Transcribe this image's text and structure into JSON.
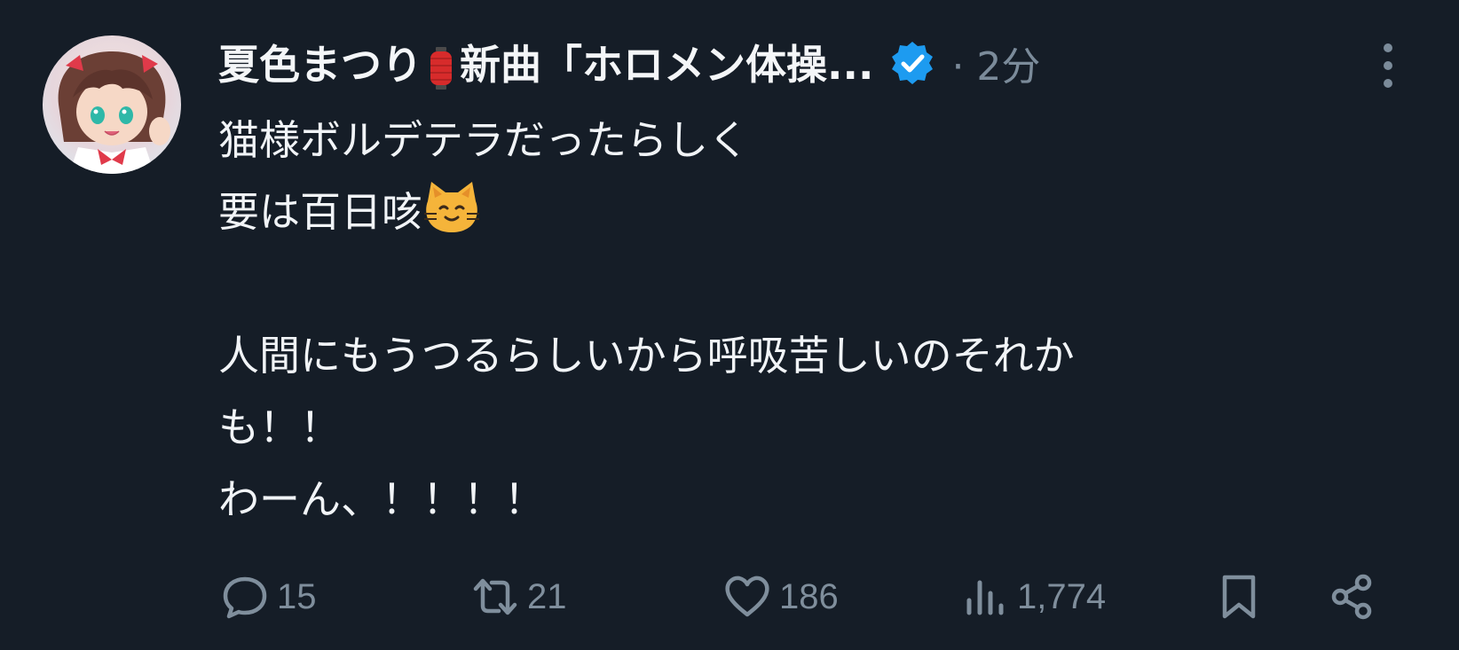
{
  "post": {
    "display_name": "夏色まつり",
    "name_emoji": "red-paper-lantern",
    "name_suffix": "新曲「ホロメン体操...",
    "timestamp": "· 2分",
    "body_lines": [
      "猫様ボルデテラだったらしく",
      "要は百日咳",
      "",
      "人間にもうつるらしいから呼吸苦しいのそれか",
      "も！！",
      "わーん、！！！！"
    ],
    "body_emoji": "cat-face"
  },
  "actions": {
    "replies": "15",
    "reposts": "21",
    "likes": "186",
    "views": "1,774"
  },
  "colors": {
    "background": "#151d27",
    "text": "#f1f4f7",
    "muted": "#7f8e9c",
    "verified": "#1d9bf0",
    "lantern": "#d72b2b"
  }
}
